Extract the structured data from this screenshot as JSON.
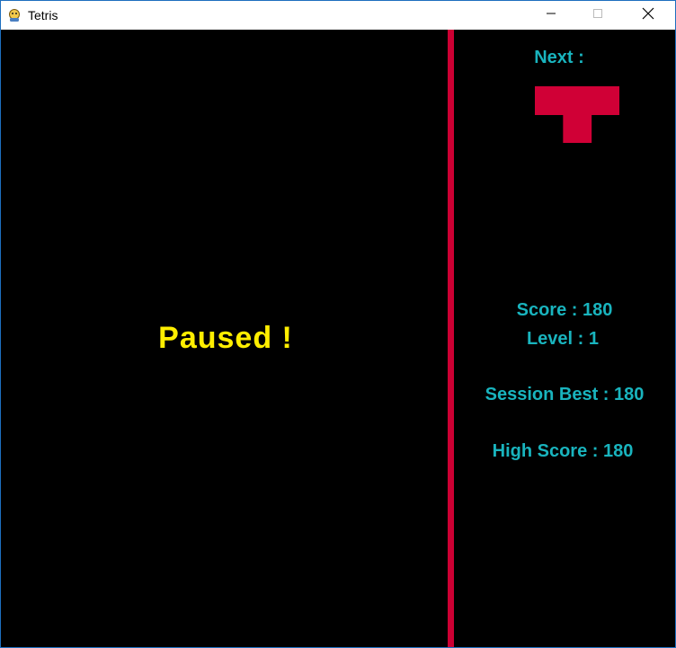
{
  "window": {
    "title": "Tetris",
    "app_icon": "pygame-snake-icon",
    "controls": [
      "minimize-icon",
      "maximize-icon",
      "close-icon"
    ]
  },
  "game": {
    "status_text": "Paused !",
    "next_label": "Next :",
    "next_piece": {
      "shape": "T",
      "cells": [
        [
          1,
          1,
          1
        ],
        [
          0,
          1,
          0
        ]
      ]
    },
    "score_text": "Score : 180",
    "level_text": "Level : 1",
    "session_best_text": "Session Best : 180",
    "high_score_text": "High Score : 180"
  },
  "colors": {
    "background": "#000000",
    "divider": "#cc0033",
    "piece": "#d00036",
    "paused_text": "#ffee00",
    "info_text": "#19b4be"
  }
}
